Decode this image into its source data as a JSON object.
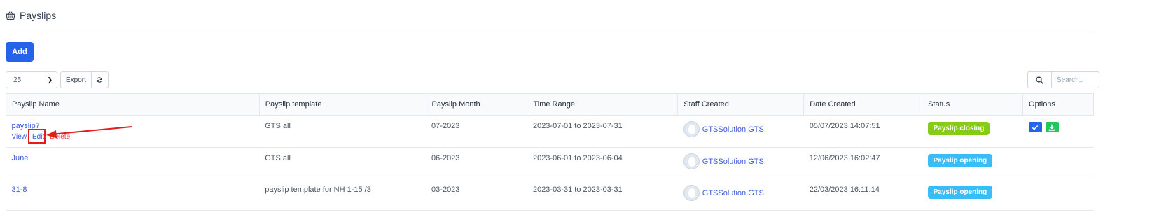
{
  "header": {
    "title": "Payslips",
    "icon": "basket-icon"
  },
  "toolbar": {
    "add_label": "Add",
    "page_length": "25",
    "export_label": "Export",
    "search_placeholder": "Search.."
  },
  "table": {
    "columns": [
      "Payslip Name",
      "Payslip template",
      "Payslip Month",
      "Time Range",
      "Staff Created",
      "Date Created",
      "Status",
      "Options"
    ],
    "rows": [
      {
        "name": "payslip7",
        "actions": {
          "view": "View",
          "edit": "Edit",
          "delete": "Delete"
        },
        "template": "GTS all",
        "month": "07-2023",
        "range": "2023-07-01 to 2023-07-31",
        "staff": "GTSSolution GTS",
        "date": "05/07/2023 14:07:51",
        "status": "Payslip closing"
      },
      {
        "name": "June",
        "template": "GTS all",
        "month": "06-2023",
        "range": "2023-06-01 to 2023-06-04",
        "staff": "GTSSolution GTS",
        "date": "12/06/2023 16:02:47",
        "status": "Payslip opening"
      },
      {
        "name": "31-8",
        "template": "payslip template for NH 1-15 /3",
        "month": "03-2023",
        "range": "2023-03-31 to 2023-03-31",
        "staff": "GTSSolution GTS",
        "date": "22/03/2023 16:11:14",
        "status": "Payslip opening"
      }
    ]
  },
  "colors": {
    "primary": "#2563eb",
    "closing": "#84cc16",
    "opening": "#38bdf8",
    "link": "#3b5bdb",
    "delete": "#ef4444",
    "annotation": "#e11d1d"
  }
}
